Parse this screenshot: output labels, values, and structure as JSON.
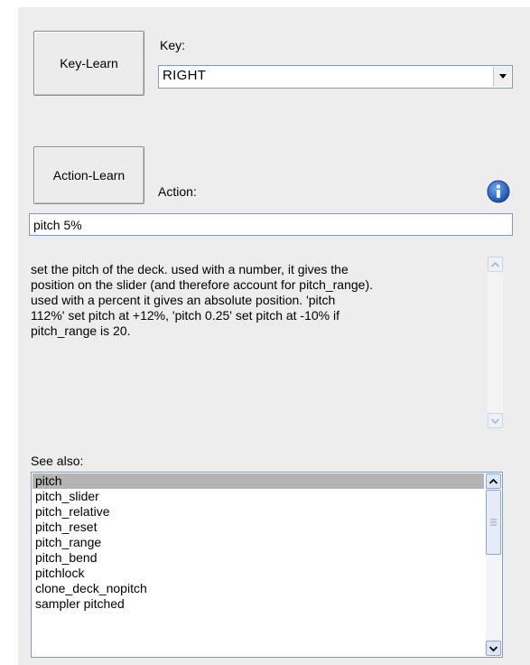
{
  "key_section": {
    "learn_button": "Key-Learn",
    "label": "Key:",
    "selected_value": "RIGHT"
  },
  "action_section": {
    "learn_button": "Action-Learn",
    "label": "Action:",
    "value": "pitch 5%",
    "info_icon": "info-icon",
    "description": "set the pitch of the deck. used with a number, it gives the\nposition on the slider (and therefore account for pitch_range).\nused with a percent it gives an absolute position.  'pitch\n112%' set pitch at +12%, 'pitch 0.25' set pitch at -10% if\npitch_range is 20."
  },
  "see_also": {
    "label": "See also:",
    "items": [
      "pitch",
      "pitch_slider",
      "pitch_relative",
      "pitch_reset",
      "pitch_range",
      "pitch_bend",
      "pitchlock",
      "clone_deck_nopitch",
      "sampler pitched"
    ],
    "selected_index": 0
  },
  "colors": {
    "panel_bg": "#ededed",
    "field_border": "#7f9db9",
    "selection_bg": "#b4b4b4",
    "info_blue": "#1e5fc8"
  }
}
